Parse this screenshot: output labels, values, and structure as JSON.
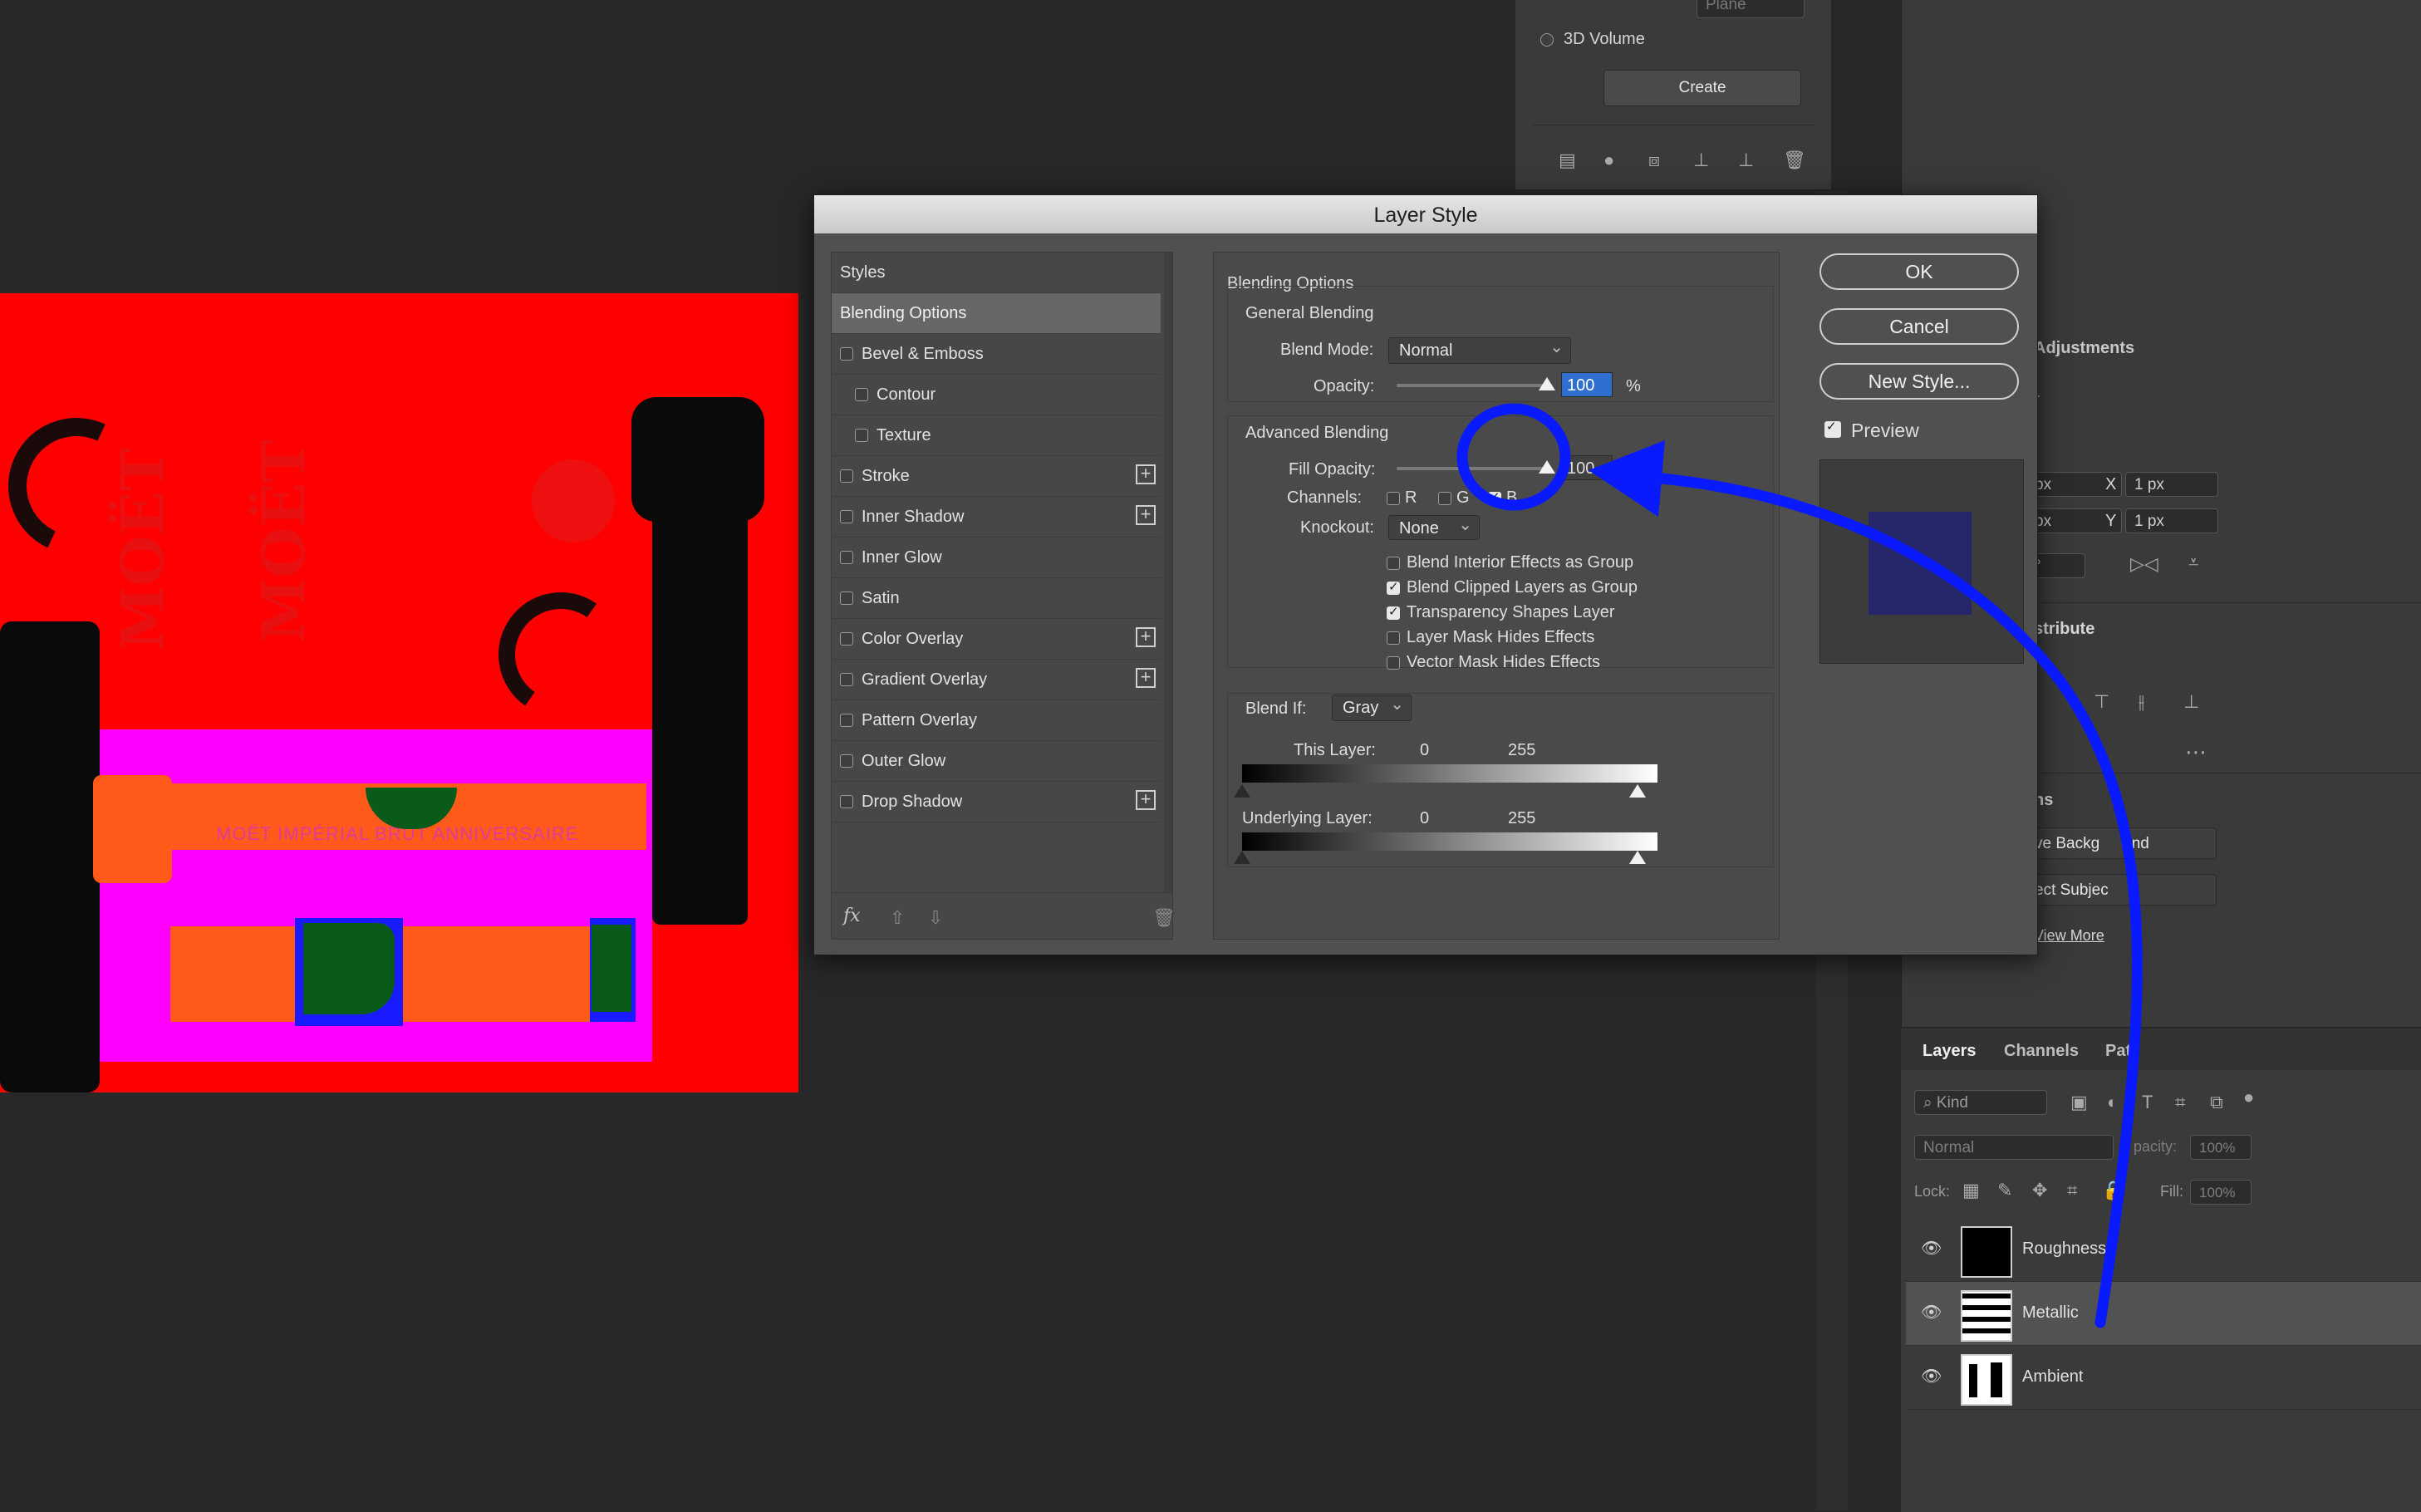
{
  "canvas": {
    "watermark1": "MOËT",
    "watermark2": "MOËT",
    "label_text": "MOËT IMPÉRIAL BRUT ANNIVERSAIRE"
  },
  "props3d": {
    "plane_label": "Plane",
    "volume_label": "3D Volume",
    "create_label": "Create"
  },
  "properties": {
    "adjustments_label": "Adjustments",
    "partial_r": "r",
    "w_field": "px",
    "x_label": "X",
    "x_value": "1 px",
    "h_field": "px",
    "y_label": "Y",
    "y_value": "1 px",
    "deg_field": "°",
    "distribute_label": "stribute",
    "actions_label": "ns",
    "remove_bg": "ve Backg",
    "remove_bg_tail": "und",
    "select_subject": "ect Subjec",
    "view_more": "View More"
  },
  "layers_panel": {
    "tabs": [
      "Layers",
      "Channels",
      "Pat"
    ],
    "kind_label": "Kind",
    "blend_mode": "Normal",
    "opacity_label": "pacity:",
    "opacity_value": "100%",
    "lock_label": "Lock:",
    "fill_label": "Fill:",
    "fill_value": "100%",
    "layers": [
      {
        "name": "Roughness"
      },
      {
        "name": "Metallic"
      },
      {
        "name": "Ambient"
      }
    ]
  },
  "dialog": {
    "title": "Layer Style",
    "styles_header": "Styles",
    "styles": [
      {
        "label": "Blending Options",
        "selected": true
      },
      {
        "label": "Bevel & Emboss",
        "checked": false
      },
      {
        "label": "Contour",
        "checked": false,
        "sub": true
      },
      {
        "label": "Texture",
        "checked": false,
        "sub": true
      },
      {
        "label": "Stroke",
        "checked": false,
        "plus": true
      },
      {
        "label": "Inner Shadow",
        "checked": false,
        "plus": true
      },
      {
        "label": "Inner Glow",
        "checked": false
      },
      {
        "label": "Satin",
        "checked": false
      },
      {
        "label": "Color Overlay",
        "checked": false,
        "plus": true
      },
      {
        "label": "Gradient Overlay",
        "checked": false,
        "plus": true
      },
      {
        "label": "Pattern Overlay",
        "checked": false
      },
      {
        "label": "Outer Glow",
        "checked": false
      },
      {
        "label": "Drop Shadow",
        "checked": false,
        "plus": true
      }
    ],
    "fx_label": "fx",
    "blending_options": "Blending Options",
    "general_blending": "General Blending",
    "blend_mode_label": "Blend Mode:",
    "blend_mode_value": "Normal",
    "opacity_label": "Opacity:",
    "opacity_value": "100",
    "percent": "%",
    "advanced_blending": "Advanced Blending",
    "fill_opacity_label": "Fill Opacity:",
    "fill_opacity_value": "100",
    "channels_label": "Channels:",
    "channel_r": "R",
    "channel_g": "G",
    "channel_b": "B",
    "knockout_label": "Knockout:",
    "knockout_value": "None",
    "options": [
      {
        "label": "Blend Interior Effects as Group",
        "checked": false
      },
      {
        "label": "Blend Clipped Layers as Group",
        "checked": true
      },
      {
        "label": "Transparency Shapes Layer",
        "checked": true
      },
      {
        "label": "Layer Mask Hides Effects",
        "checked": false
      },
      {
        "label": "Vector Mask Hides Effects",
        "checked": false
      }
    ],
    "blend_if_label": "Blend If:",
    "blend_if_value": "Gray",
    "this_layer_label": "This Layer:",
    "this_layer_min": "0",
    "this_layer_max": "255",
    "underlying_label": "Underlying Layer:",
    "underlying_min": "0",
    "underlying_max": "255",
    "ok_label": "OK",
    "cancel_label": "Cancel",
    "new_style_label": "New Style...",
    "preview_label": "Preview",
    "preview_checked": true
  },
  "colors": {
    "annotation": "#0a1aff",
    "canvas_bg": "#ff0000",
    "magenta": "#ff00ff"
  }
}
